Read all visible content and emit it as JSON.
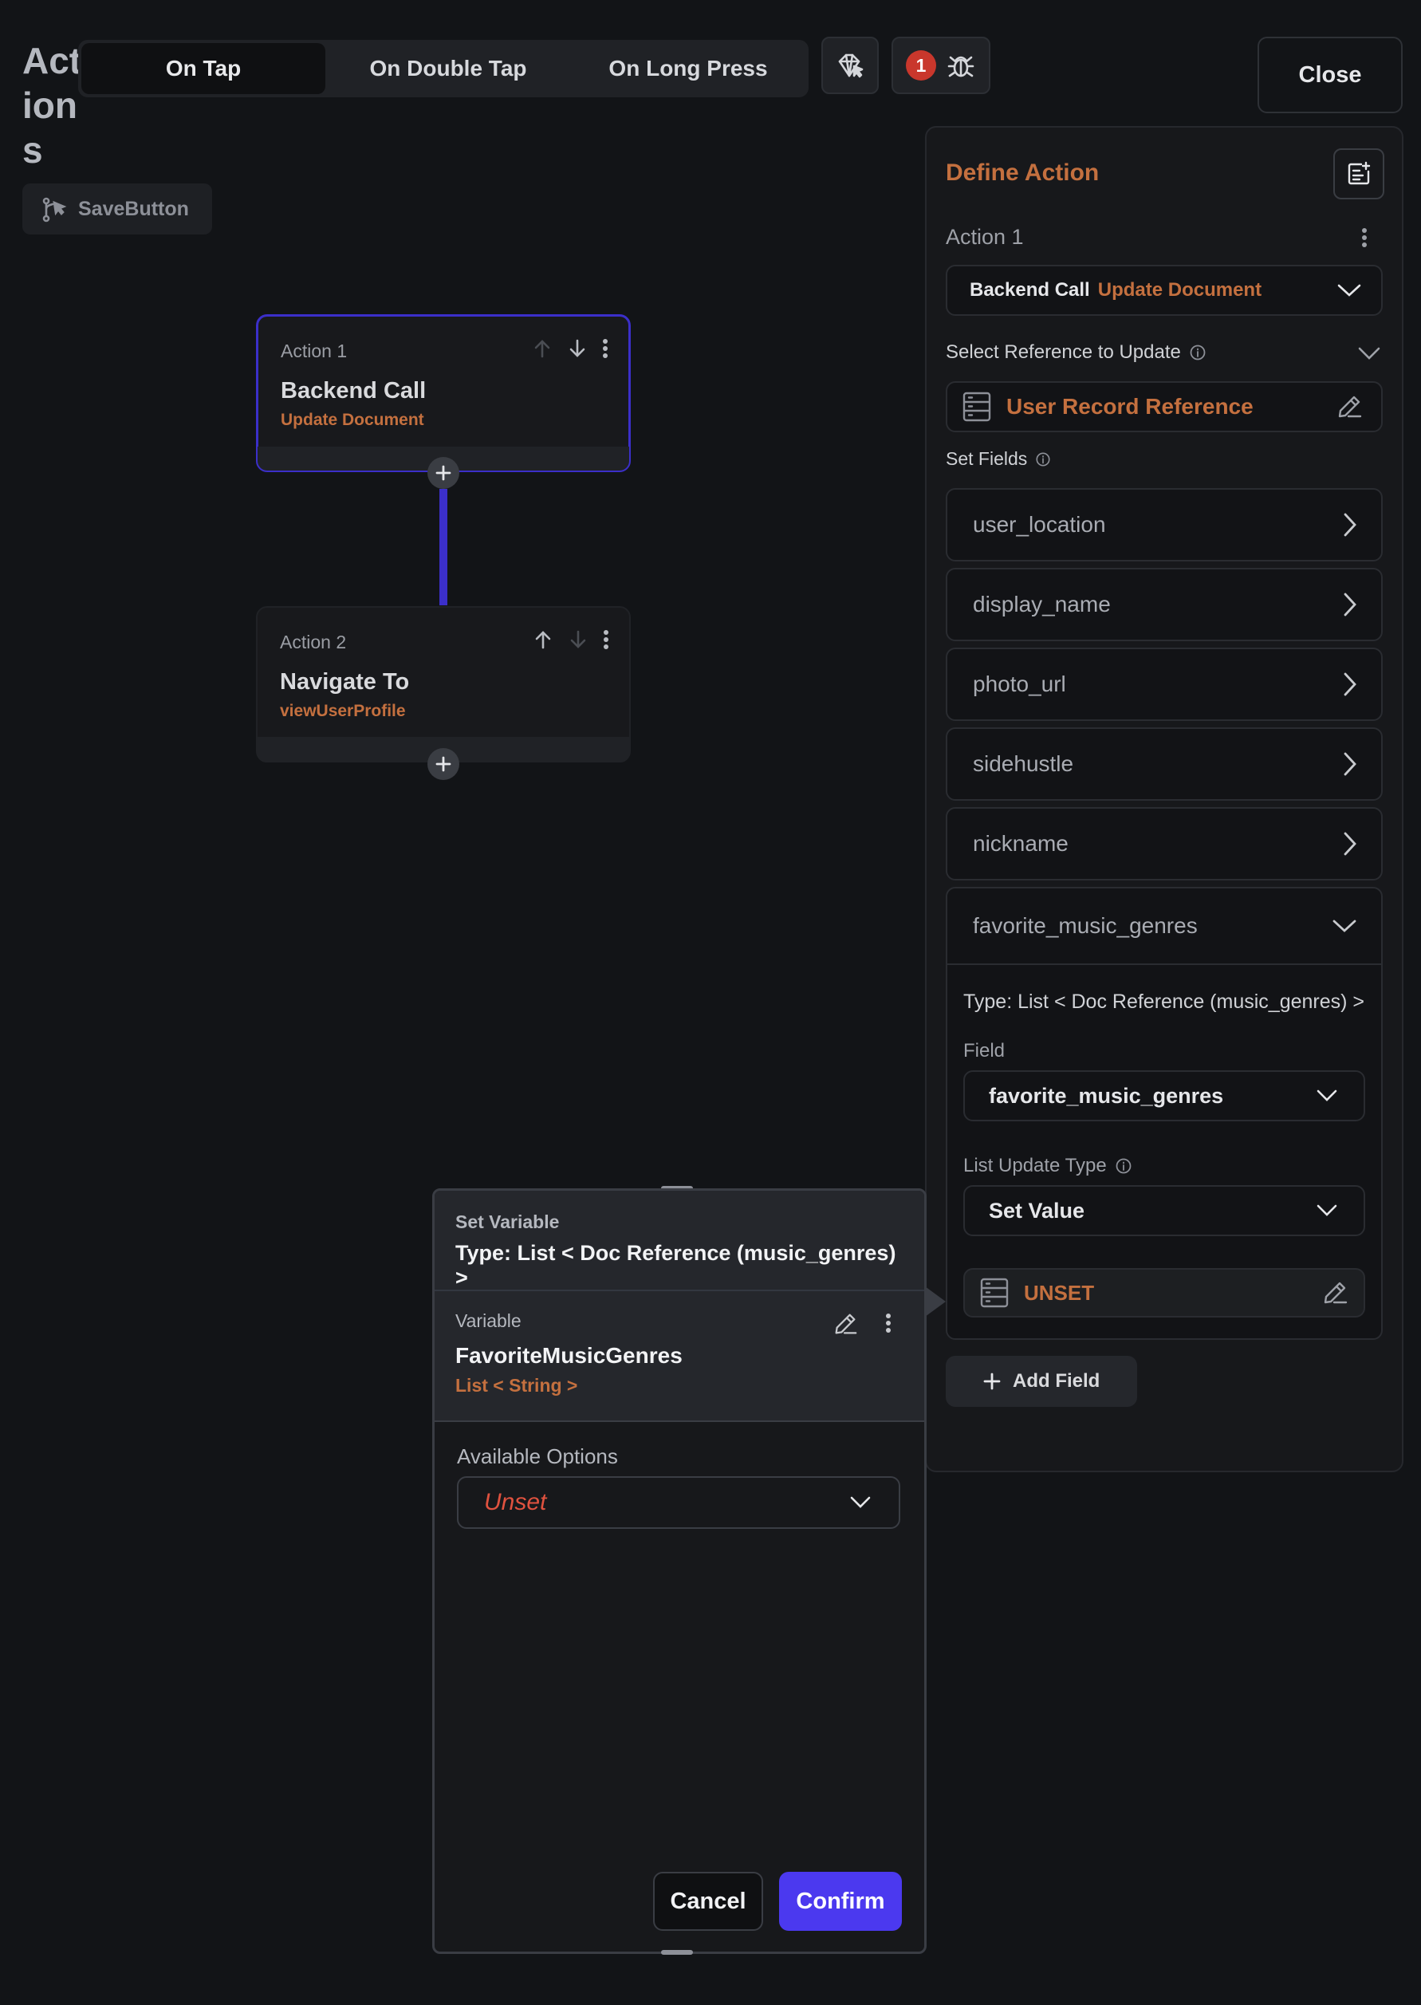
{
  "header": {
    "title": "Actions",
    "tabs": [
      {
        "label": "On Tap",
        "active": true
      },
      {
        "label": "On Double Tap",
        "active": false
      },
      {
        "label": "On Long Press",
        "active": false
      }
    ],
    "error_count": "1",
    "close_label": "Close",
    "widget_name": "SaveButton"
  },
  "actions": [
    {
      "label": "Action 1",
      "title": "Backend Call",
      "subtitle": "Update Document"
    },
    {
      "label": "Action 2",
      "title": "Navigate To",
      "subtitle": "viewUserProfile"
    }
  ],
  "panel": {
    "title": "Define Action",
    "action_label": "Action 1",
    "action_type": "Backend Call",
    "action_subtype": "Update Document",
    "reference_label": "Select Reference to Update",
    "reference_value": "User Record Reference",
    "set_fields_label": "Set Fields",
    "fields": [
      "user_location",
      "display_name",
      "photo_url",
      "sidehustle",
      "nickname"
    ],
    "expanded_field": {
      "name": "favorite_music_genres",
      "type_text": "Type: List < Doc Reference (music_genres) >",
      "field_label": "Field",
      "field_value": "favorite_music_genres",
      "update_type_label": "List Update Type",
      "update_type_value": "Set Value",
      "value": "UNSET"
    },
    "add_field_label": "Add Field"
  },
  "modal": {
    "title": "Set Variable",
    "type_text": "Type: List < Doc Reference (music_genres) >",
    "variable_label": "Variable",
    "variable_name": "FavoriteMusicGenres",
    "variable_type": "List < String >",
    "options_label": "Available Options",
    "options_value": "Unset",
    "cancel_label": "Cancel",
    "confirm_label": "Confirm"
  },
  "colors": {
    "accent_orange": "#c4703f",
    "accent_purple": "#4b39ef",
    "error_red": "#e0523f",
    "connector": "#3b2fc9"
  }
}
